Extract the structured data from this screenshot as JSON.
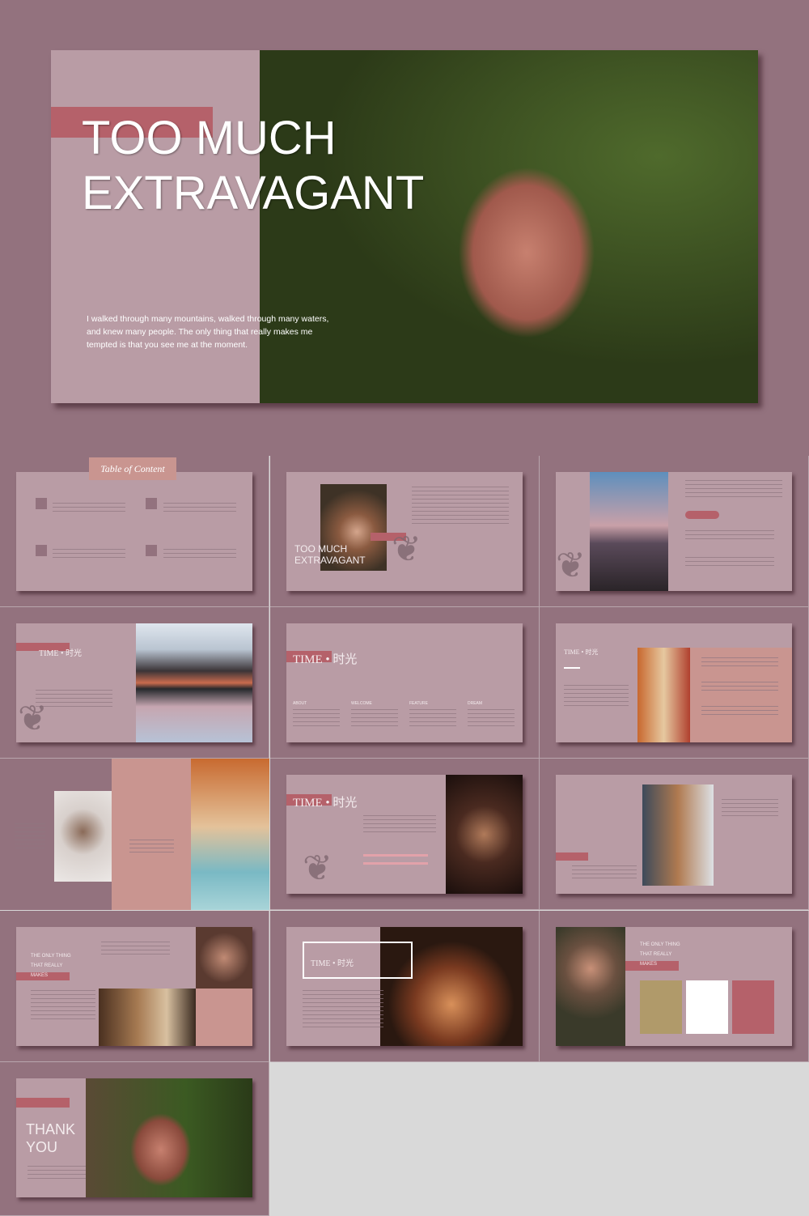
{
  "hero": {
    "title_line1": "TOO MUCH",
    "title_line2": "EXTRAVAGANT",
    "body": "I walked through many mountains, walked through many waters, and knew many people. The only thing that really makes me tempted is that you see me at the moment."
  },
  "slides": {
    "toc": {
      "title": "Table of Content"
    },
    "cover": {
      "title_line1": "TOO MUCH",
      "title_line2": "EXTRAVAGANT"
    },
    "time": {
      "label": "TIME • 时光",
      "columns": [
        "ABOUT",
        "WELCOME",
        "FEATURE",
        "DREAM"
      ]
    },
    "makes": {
      "line1": "THE ONLY THING",
      "line2": "THAT REALLY",
      "line3": "MAKES"
    },
    "thanks": {
      "line1": "THANK",
      "line2": "YOU"
    }
  },
  "colors": {
    "background": "#93727e",
    "slide": "#b99ca5",
    "accent": "#b5616a",
    "salmon": "#c99590",
    "gold": "#b09a6a"
  }
}
